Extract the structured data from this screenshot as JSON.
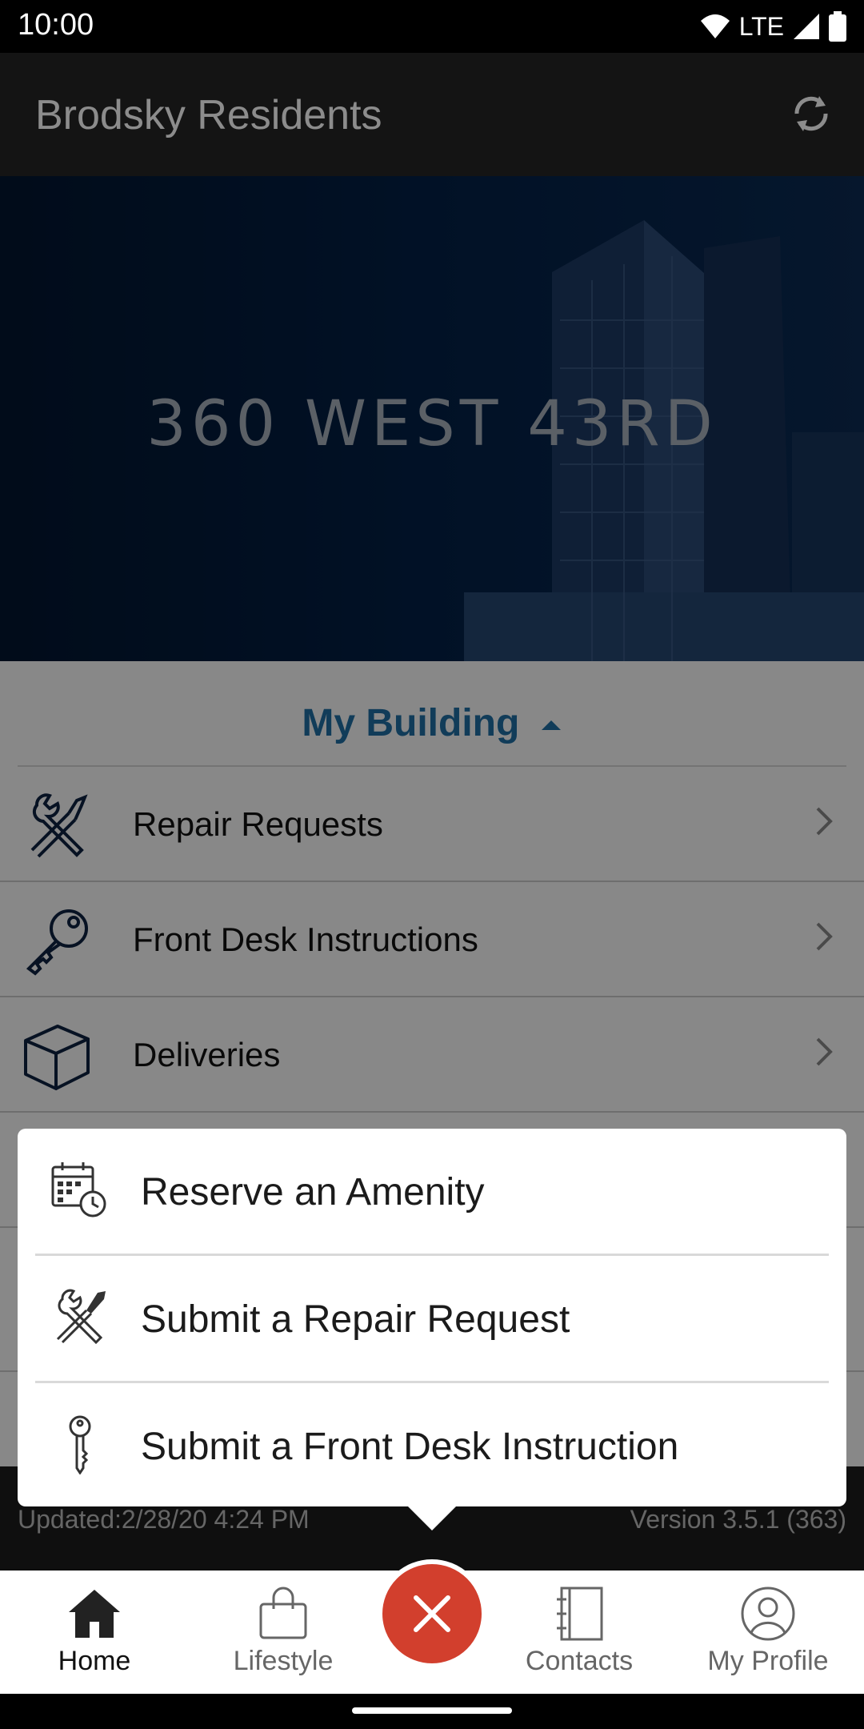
{
  "status_bar": {
    "time": "10:00",
    "network": "LTE"
  },
  "app_bar": {
    "title": "Brodsky Residents"
  },
  "hero": {
    "building_name": "360 WEST 43RD"
  },
  "my_building": {
    "title": "My Building",
    "items": [
      {
        "label": "Repair Requests",
        "icon": "tools-icon"
      },
      {
        "label": "Front Desk Instructions",
        "icon": "key-icon"
      },
      {
        "label": "Deliveries",
        "icon": "box-icon"
      }
    ]
  },
  "footer": {
    "updated": "Updated:2/28/20 4:24 PM",
    "version": "Version 3.5.1 (363)"
  },
  "quick_actions": [
    {
      "label": "Reserve an Amenity",
      "icon": "calendar-clock-icon"
    },
    {
      "label": "Submit a Repair Request",
      "icon": "tools-icon"
    },
    {
      "label": "Submit a Front Desk Instruction",
      "icon": "key-icon"
    }
  ],
  "bottom_nav": [
    {
      "label": "Home",
      "icon": "home-icon",
      "active": true
    },
    {
      "label": "Lifestyle",
      "icon": "shopping-bag-icon",
      "active": false
    },
    {
      "label": "Contacts",
      "icon": "contacts-book-icon",
      "active": false
    },
    {
      "label": "My Profile",
      "icon": "profile-icon",
      "active": false
    }
  ],
  "colors": {
    "accent": "#1f6ea3",
    "fab": "#d23f2d",
    "appbar": "#252525",
    "hero_bg": "#021630"
  }
}
